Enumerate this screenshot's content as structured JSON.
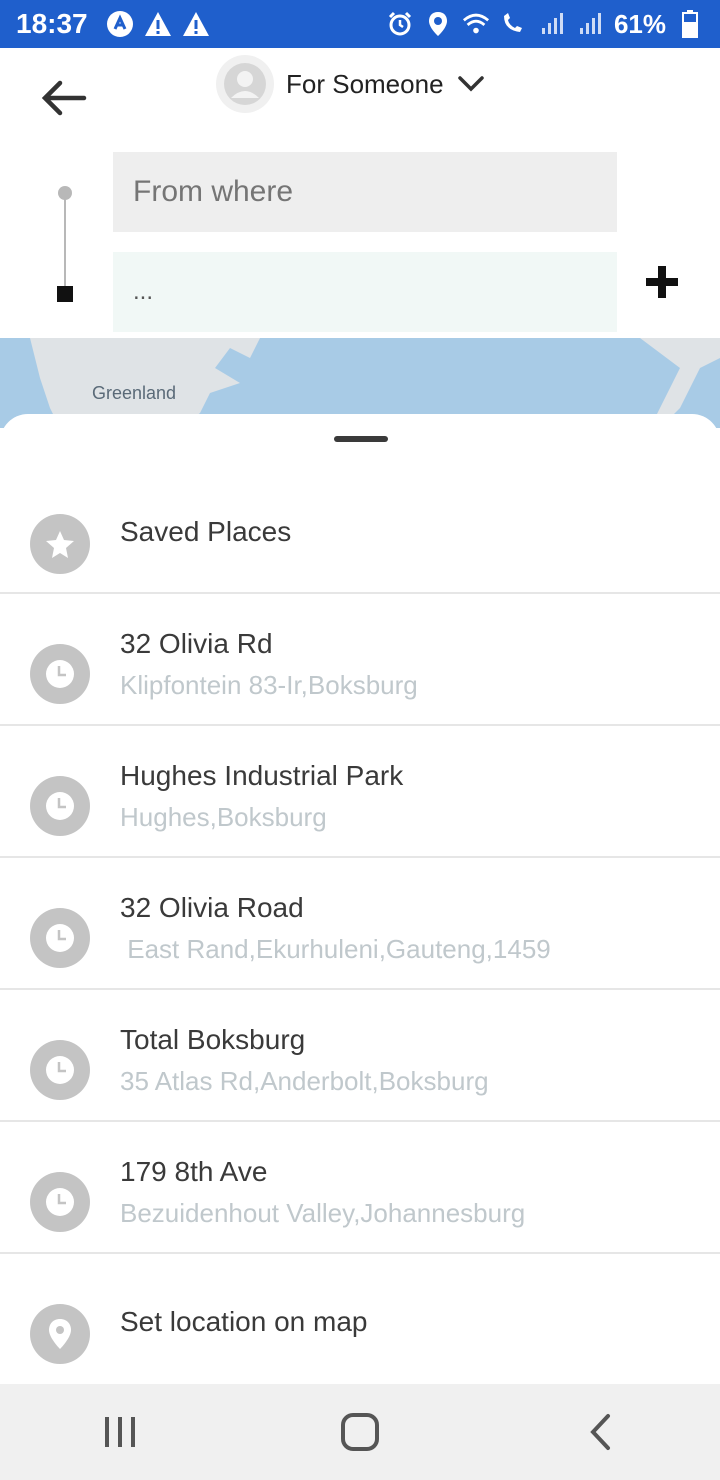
{
  "status_bar": {
    "time": "18:37",
    "battery": "61%"
  },
  "header": {
    "rider_label": "For Someone",
    "from_placeholder": "From where",
    "to_value": "..."
  },
  "map": {
    "label": "Greenland"
  },
  "list": {
    "saved": {
      "title": "Saved Places"
    },
    "recent": [
      {
        "title": "32 Olivia Rd",
        "subtitle": "Klipfontein 83-Ir,Boksburg"
      },
      {
        "title": "Hughes Industrial Park",
        "subtitle": "Hughes,Boksburg"
      },
      {
        "title": "32 Olivia Road",
        "subtitle": " East Rand,Ekurhuleni,Gauteng,1459"
      },
      {
        "title": "Total Boksburg",
        "subtitle": "35 Atlas Rd,Anderbolt,Boksburg"
      },
      {
        "title": "179 8th Ave",
        "subtitle": "Bezuidenhout Valley,Johannesburg"
      }
    ],
    "set_on_map": {
      "title": "Set location on map"
    }
  },
  "colors": {
    "status_bar": "#1f5fcc",
    "map_water": "#a8cbe6",
    "icon_circle": "#c4c4c4",
    "subtitle": "#c0c8cc"
  }
}
